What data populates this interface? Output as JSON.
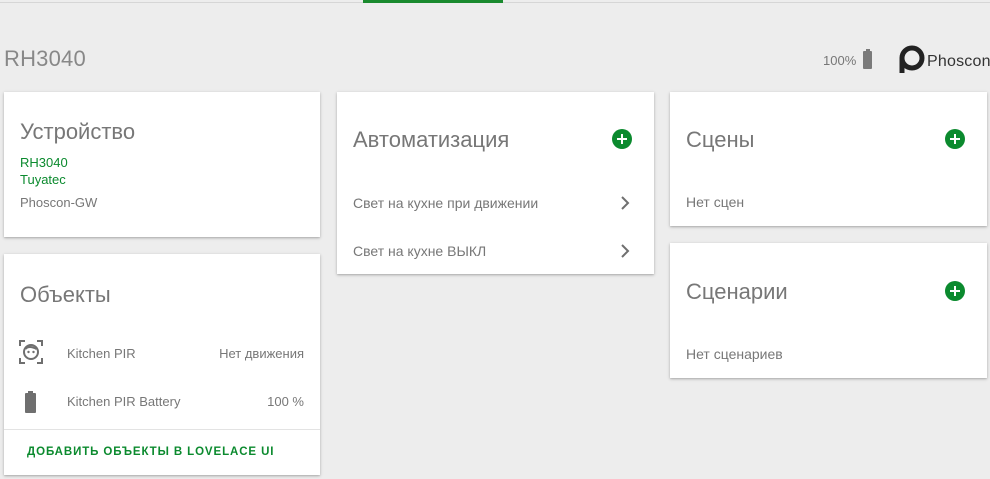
{
  "header": {
    "title": "RH3040",
    "battery_text": "100%",
    "logo_text": "Phoscon"
  },
  "device_card": {
    "title": "Устройство",
    "model": "RH3040",
    "manufacturer": "Tuyatec",
    "gateway": "Phoscon-GW"
  },
  "objects_card": {
    "title": "Объекты",
    "items": [
      {
        "name": "Kitchen PIR",
        "value": "Нет движения",
        "icon": "motion-sensor-icon"
      },
      {
        "name": "Kitchen PIR Battery",
        "value": "100 %",
        "icon": "battery-icon"
      }
    ],
    "action_label": "ДОБАВИТЬ ОБЪЕКТЫ В LOVELACE UI"
  },
  "automation_card": {
    "title": "Автоматизация",
    "items": [
      {
        "label": "Свет на кухне при движении"
      },
      {
        "label": "Свет на кухне ВЫКЛ"
      }
    ]
  },
  "scenes_card": {
    "title": "Сцены",
    "empty_text": "Нет сцен"
  },
  "scenarios_card": {
    "title": "Сценарии",
    "empty_text": "Нет сценариев"
  },
  "colors": {
    "accent": "#0b8a2e",
    "background": "#ededed",
    "card": "#ffffff",
    "text": "#777777"
  }
}
